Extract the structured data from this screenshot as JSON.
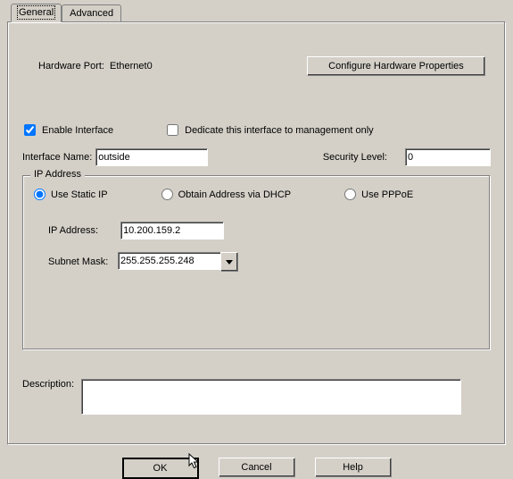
{
  "tabs": {
    "general": "General",
    "advanced": "Advanced"
  },
  "hardware": {
    "label": "Hardware Port:",
    "value": "Ethernet0",
    "configure_btn": "Configure Hardware Properties"
  },
  "enable_interface": {
    "label": "Enable Interface",
    "checked": true
  },
  "dedicate_mgmt": {
    "label": "Dedicate this interface to management only",
    "checked": false
  },
  "interface_name": {
    "label": "Interface Name:",
    "value": "outside"
  },
  "security_level": {
    "label": "Security Level:",
    "value": "0"
  },
  "ip_group": {
    "title": "IP Address",
    "static_label": "Use Static IP",
    "dhcp_label": "Obtain Address via DHCP",
    "pppoe_label": "Use PPPoE",
    "selected": "static",
    "ip_label": "IP Address:",
    "ip_value": "10.200.159.2",
    "mask_label": "Subnet Mask:",
    "mask_value": "255.255.255.248"
  },
  "description": {
    "label": "Description:",
    "value": ""
  },
  "buttons": {
    "ok": "OK",
    "cancel": "Cancel",
    "help": "Help"
  }
}
